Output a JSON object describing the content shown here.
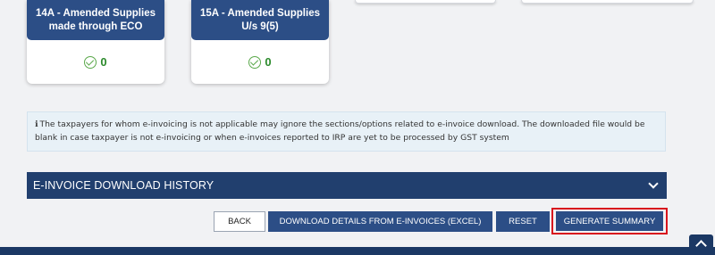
{
  "cards": [
    {
      "title": "14A - Amended Supplies made through ECO",
      "count": "0"
    },
    {
      "title": "15A - Amended Supplies U/s 9(5)",
      "count": "0"
    }
  ],
  "notice": {
    "icon": "info-icon",
    "text": "The taxpayers for whom e-invoicing is not applicable may ignore the sections/options related to e-invoice download. The downloaded file would be blank in case taxpayer is not e-invoicing or when e-invoices reported to IRP are yet to be processed by GST system"
  },
  "history": {
    "title": "E-INVOICE DOWNLOAD HISTORY"
  },
  "actions": {
    "back": "BACK",
    "download": "DOWNLOAD DETAILS FROM E-INVOICES (EXCEL)",
    "reset": "RESET",
    "generate": "GENERATE SUMMARY"
  },
  "colors": {
    "primary": "#2c4e86",
    "header_dark": "#213f6e",
    "highlight": "#d8151d",
    "success": "#2c8a2c"
  }
}
